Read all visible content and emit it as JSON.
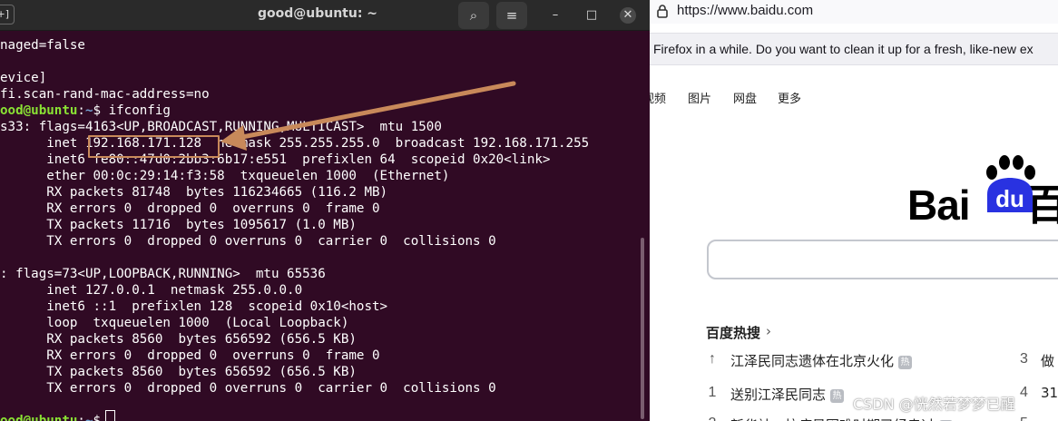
{
  "terminal": {
    "title": "good@ubuntu: ~",
    "new_tab_glyph": "+]",
    "search_glyph": "⌕",
    "menu_glyph": "≡",
    "minimize_glyph": "–",
    "maximize_glyph": "□",
    "close_glyph": "✕",
    "lines": [
      {
        "text": "naged=false"
      },
      {
        "text": ""
      },
      {
        "text": "evice]"
      },
      {
        "text": "fi.scan-rand-mac-address=no"
      },
      {
        "user": "ood@ubuntu",
        "sep": ":",
        "path": "~",
        "cmd": "$ ifconfig"
      },
      {
        "text": "s33: flags=4163<UP,BROADCAST,RUNNING,MULTICAST>  mtu 1500"
      },
      {
        "text": "      inet 192.168.171.128  netmask 255.255.255.0  broadcast 192.168.171.255"
      },
      {
        "text": "      inet6 fe80::47d0:2bb3:6b17:e551  prefixlen 64  scopeid 0x20<link>"
      },
      {
        "text": "      ether 00:0c:29:14:f3:58  txqueuelen 1000  (Ethernet)"
      },
      {
        "text": "      RX packets 81748  bytes 116234665 (116.2 MB)"
      },
      {
        "text": "      RX errors 0  dropped 0  overruns 0  frame 0"
      },
      {
        "text": "      TX packets 11716  bytes 1095617 (1.0 MB)"
      },
      {
        "text": "      TX errors 0  dropped 0 overruns 0  carrier 0  collisions 0"
      },
      {
        "text": ""
      },
      {
        "text": ": flags=73<UP,LOOPBACK,RUNNING>  mtu 65536"
      },
      {
        "text": "      inet 127.0.0.1  netmask 255.0.0.0"
      },
      {
        "text": "      inet6 ::1  prefixlen 128  scopeid 0x10<host>"
      },
      {
        "text": "      loop  txqueuelen 1000  (Local Loopback)"
      },
      {
        "text": "      RX packets 8560  bytes 656592 (656.5 KB)"
      },
      {
        "text": "      RX errors 0  dropped 0  overruns 0  frame 0"
      },
      {
        "text": "      TX packets 8560  bytes 656592 (656.5 KB)"
      },
      {
        "text": "      TX errors 0  dropped 0 overruns 0  carrier 0  collisions 0"
      },
      {
        "text": ""
      },
      {
        "user": "ood@ubuntu",
        "sep": ":",
        "path": "~",
        "cmd": "$ "
      }
    ],
    "highlight_color": "#c8895a"
  },
  "browser": {
    "url": "https://www.baidu.com",
    "notice": "Firefox in a while. Do you want to clean it up for a fresh, like-new ex",
    "nav": [
      "视频",
      "图片",
      "网盘",
      "更多"
    ],
    "logo_text": "Bai",
    "logo_du": "du",
    "logo_tail": "百",
    "hot_title": "百度热搜",
    "hot_chevron": "›",
    "hot_items": [
      {
        "rank": "↑",
        "text": "江泽民同志遗体在北京火化",
        "badge": "热"
      },
      {
        "rank": "1",
        "text": "送别江泽民同志",
        "badge": "热"
      },
      {
        "rank": "2",
        "text": "新华社：抗疫最困难时期已经走过",
        "badge": "热"
      }
    ],
    "hot_items_right": [
      {
        "rank": "3",
        "text": "做"
      },
      {
        "rank": "4",
        "text": "31"
      },
      {
        "rank": "5",
        "text": ""
      }
    ],
    "watermark": "CSDN @恍然若梦梦已醒",
    "brand_blue": "#2932e1"
  }
}
